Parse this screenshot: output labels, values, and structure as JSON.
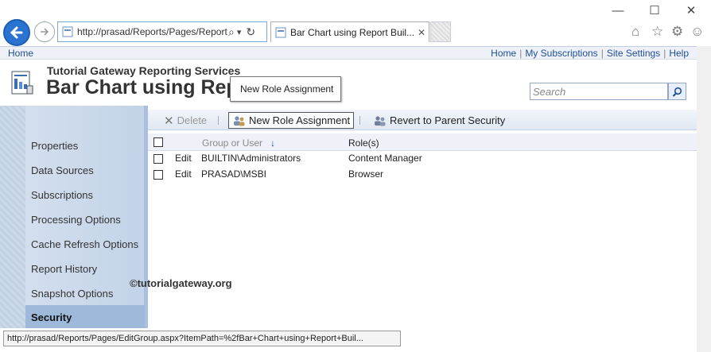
{
  "browser": {
    "address_url": "http://prasad/Reports/Pages/Report",
    "tab_title": "Bar Chart using Report Buil...",
    "minimize_glyph": "—",
    "maximize_glyph": "☐",
    "close_glyph": "✕",
    "tab_close_glyph": "✕",
    "search_glyph": "⌕",
    "dropdown_glyph": "▾",
    "refresh_glyph": "↻",
    "home_glyph": "⌂",
    "star_glyph": "☆",
    "settings_glyph": "⚙",
    "feedback_glyph": "☺"
  },
  "topnav": {
    "home": "Home",
    "my_subscriptions": "My Subscriptions",
    "site_settings": "Site Settings",
    "help": "Help",
    "separator": "|"
  },
  "header": {
    "site_title": "Tutorial Gateway Reporting Services",
    "page_title": "Bar Chart using Report Builder",
    "search_placeholder": "Search",
    "tooltip": "New Role Assignment"
  },
  "leftnav": {
    "items": [
      {
        "label": "Properties"
      },
      {
        "label": "Data Sources"
      },
      {
        "label": "Subscriptions"
      },
      {
        "label": "Processing Options"
      },
      {
        "label": "Cache Refresh Options"
      },
      {
        "label": "Report History"
      },
      {
        "label": "Snapshot Options"
      },
      {
        "label": "Security"
      }
    ],
    "active": "Security"
  },
  "toolbar": {
    "delete_label": "Delete",
    "new_role_label": "New Role Assignment",
    "revert_label": "Revert to Parent Security",
    "delete_glyph": "✕"
  },
  "table": {
    "headers": {
      "group": "Group or User",
      "sort_glyph": "↓",
      "roles": "Role(s)"
    },
    "rows": [
      {
        "action": "Edit",
        "group": "BUILTIN\\Administrators",
        "roles": "Content Manager"
      },
      {
        "action": "Edit",
        "group": "PRASAD\\MSBI",
        "roles": "Browser"
      }
    ]
  },
  "watermark": "©tutorialgateway.org",
  "status_url": "http://prasad/Reports/Pages/EditGroup.aspx?ItemPath=%2fBar+Chart+using+Report+Buil...",
  "colors": {
    "accent": "#2a73d1",
    "nav_bg": "#c3d3e8",
    "active_nav": "#9fb9db",
    "link": "#1e4f96"
  }
}
